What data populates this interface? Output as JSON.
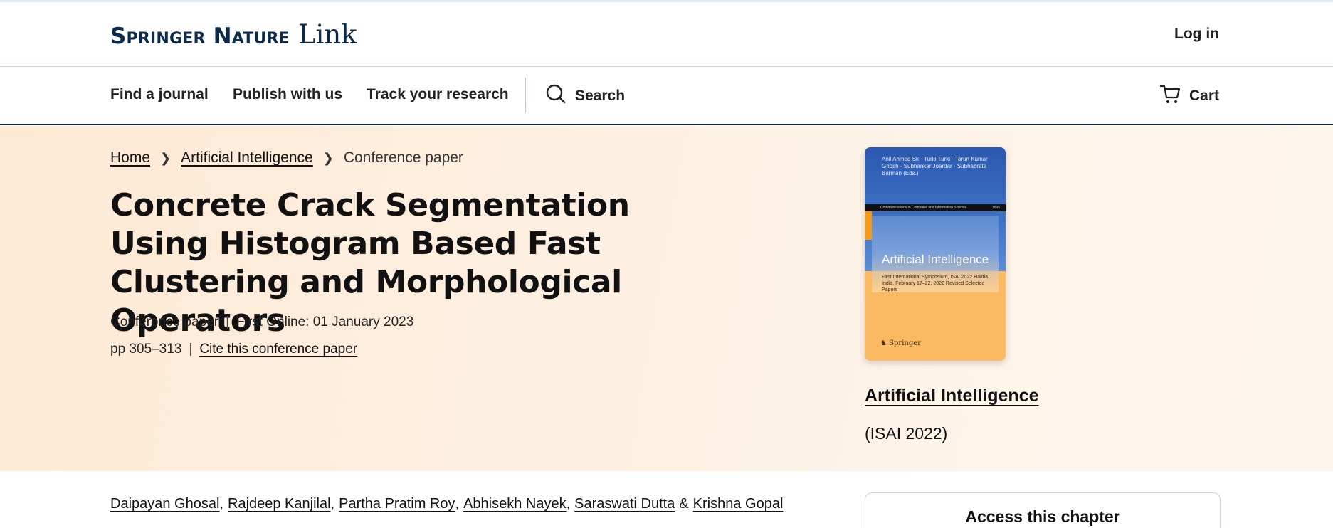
{
  "header": {
    "logo_brand": "Springer Nature",
    "logo_link": "Link",
    "login": "Log in"
  },
  "nav": {
    "items": [
      "Find a journal",
      "Publish with us",
      "Track your research"
    ],
    "search": "Search",
    "cart": "Cart"
  },
  "breadcrumb": {
    "home": "Home",
    "section": "Artificial Intelligence",
    "current": "Conference paper"
  },
  "article": {
    "title": "Concrete Crack Segmentation Using Histogram Based Fast Clustering and Morphological Operators",
    "type": "Conference paper",
    "first_online": "First Online: 01 January 2023",
    "pages": "pp 305–313",
    "cite": "Cite this conference paper"
  },
  "book": {
    "cover_authors": "Anil Ahmed Sk · Turki Turki · Tarun Kumar Ghosh · Subhankar Joardar · Subhabrata Barman (Eds.)",
    "cover_series": "Communications in Computer and Information Science",
    "cover_volume": "1695",
    "cover_title": "Artificial Intelligence",
    "cover_subtitle": "First International Symposium, ISAI 2022 Haldia, India, February 17–22, 2022 Revised Selected Papers",
    "cover_publisher": "Springer",
    "title": "Artificial Intelligence",
    "series": "(ISAI 2022)"
  },
  "authors": [
    "Daipayan Ghosal",
    "Rajdeep Kanjilal",
    "Partha Pratim Roy",
    "Abhisekh Nayek",
    "Saraswati Dutta",
    "Krishna Gopal"
  ],
  "authors_separators": [
    ",",
    ",",
    ",",
    ",",
    "&"
  ],
  "access": {
    "title": "Access this chapter"
  },
  "colors": {
    "brand_navy": "#0c2a4a",
    "hero_bg": "#fde9d4",
    "cover_blue": "#2b58b0",
    "cover_orange": "#fbb962"
  }
}
